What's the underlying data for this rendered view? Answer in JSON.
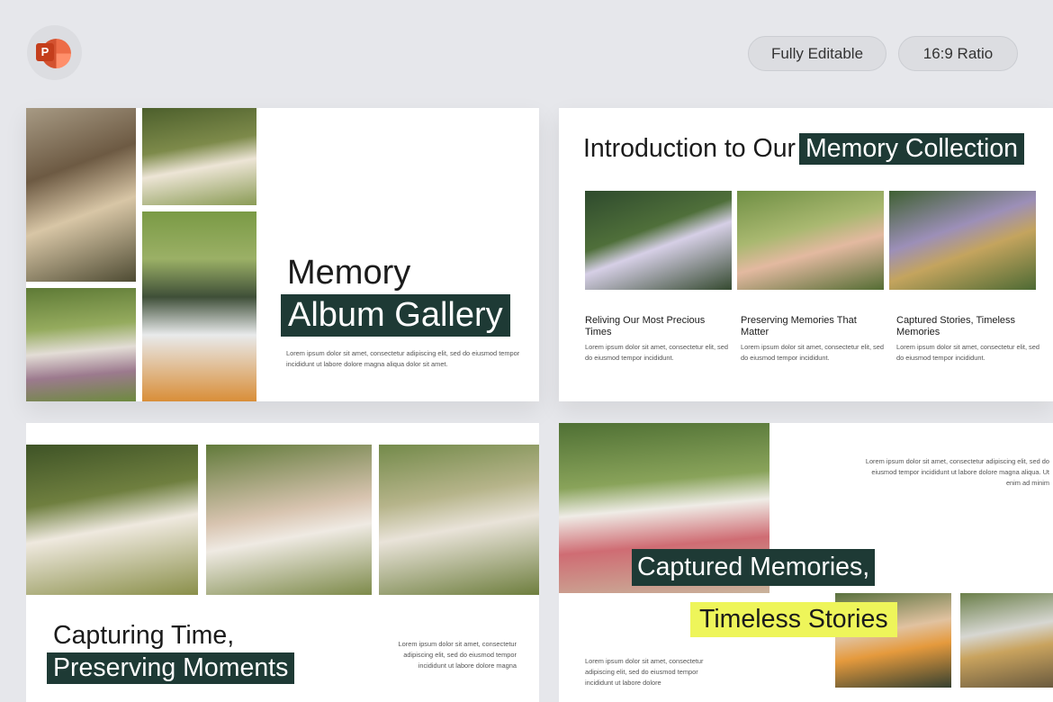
{
  "app": {
    "logo_letter": "P"
  },
  "badges": {
    "editable": "Fully Editable",
    "ratio": "16:9 Ratio"
  },
  "slide1": {
    "title_line1": "Memory",
    "title_line2": "Album Gallery",
    "body": "Lorem ipsum dolor sit amet, consectetur adipiscing elit, sed do eiusmod tempor incididunt ut labore dolore magna aliqua dolor sit amet."
  },
  "slide2": {
    "title_plain": "Introduction to Our",
    "title_highlight": "Memory Collection",
    "cards": [
      {
        "title": "Reliving Our Most Precious Times",
        "body": "Lorem ipsum dolor sit amet, consectetur elit, sed do eiusmod tempor incididunt."
      },
      {
        "title": "Preserving Memories That Matter",
        "body": "Lorem ipsum dolor sit amet, consectetur elit, sed do eiusmod tempor incididunt."
      },
      {
        "title": "Captured Stories, Timeless Memories",
        "body": "Lorem ipsum dolor sit amet, consectetur elit, sed do eiusmod tempor incididunt."
      }
    ]
  },
  "slide3": {
    "title_line1": "Capturing Time,",
    "title_line2": "Preserving Moments",
    "body": "Lorem ipsum dolor sit amet, consectetur adipiscing elit, sed do eiusmod tempor incididunt ut labore dolore magna"
  },
  "slide4": {
    "title_line1": "Captured Memories,",
    "title_line2": "Timeless Stories",
    "body_top": "Lorem ipsum dolor sit amet, consectetur adipiscing elit, sed do eiusmod tempor incididunt ut labore dolore magna aliqua. Ut enim ad minim",
    "body_bottom": "Lorem ipsum dolor sit amet, consectetur adipiscing elit, sed do eiusmod tempor incididunt ut labore dolore"
  },
  "colors": {
    "dark_highlight": "#1e3a35",
    "yellow_highlight": "#eef55a",
    "background": "#e6e7eb"
  }
}
